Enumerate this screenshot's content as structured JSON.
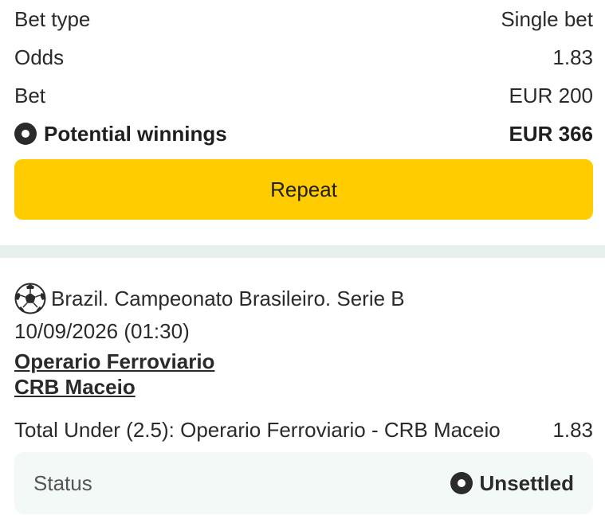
{
  "summary": {
    "bet_type_label": "Bet type",
    "bet_type_value": "Single bet",
    "odds_label": "Odds",
    "odds_value": "1.83",
    "bet_label": "Bet",
    "bet_value": "EUR 200",
    "winnings_label": "Potential winnings",
    "winnings_value": "EUR 366",
    "winnings_icon": "radio-dot-icon"
  },
  "actions": {
    "repeat_label": "Repeat",
    "repeat_color": "#ffcc00"
  },
  "event": {
    "sport_icon": "soccer-ball-icon",
    "league": "Brazil. Campeonato Brasileiro. Serie B",
    "datetime": "10/09/2026 (01:30)",
    "home_team": "Operario Ferroviario",
    "away_team": "CRB Maceio",
    "selection": "Total Under (2.5): Operario Ferroviario - CRB Maceio",
    "selection_odds": "1.83"
  },
  "status": {
    "label": "Status",
    "value": "Unsettled",
    "icon": "radio-dot-icon"
  }
}
